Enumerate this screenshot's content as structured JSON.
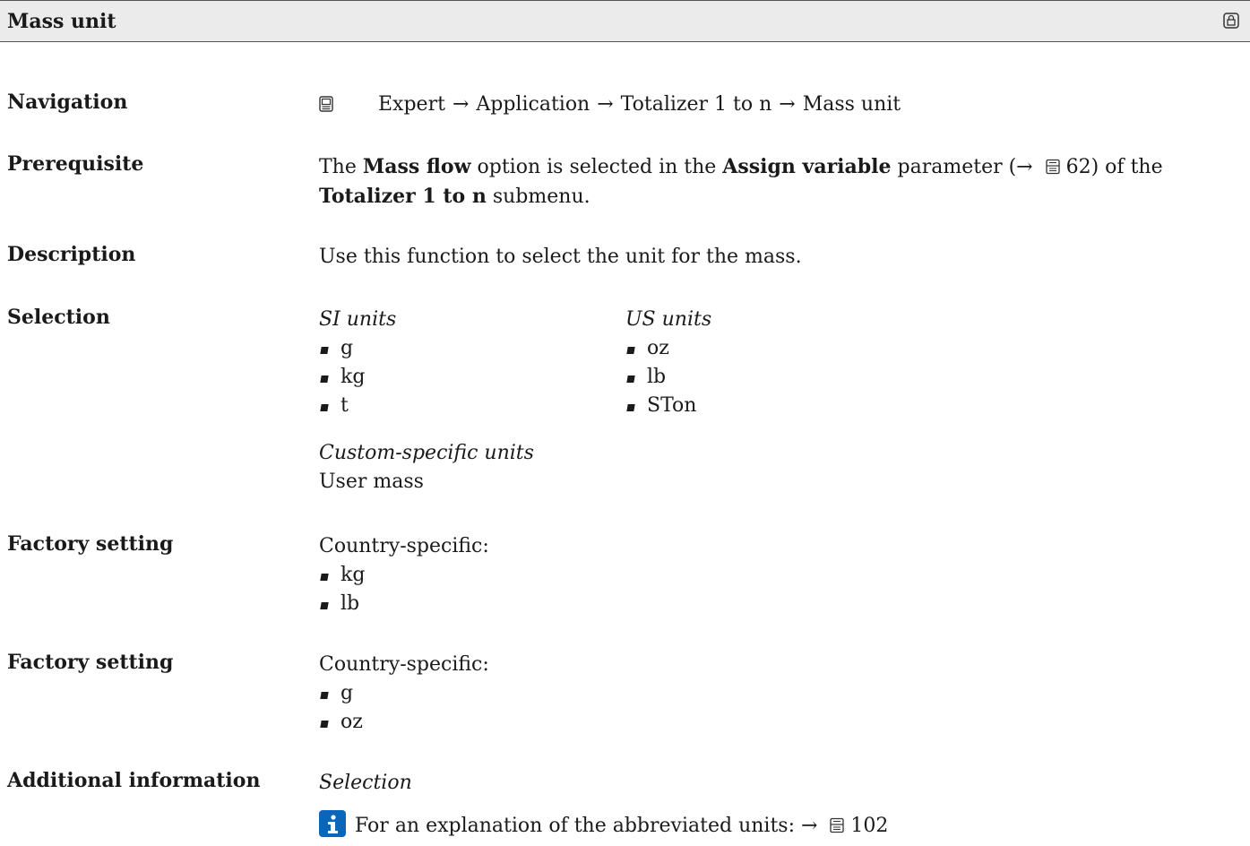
{
  "header": {
    "title": "Mass unit",
    "lock_icon": "lock-icon"
  },
  "navigation": {
    "label": "Navigation",
    "icon": "display-icon",
    "path": [
      "Expert",
      "Application",
      "Totalizer 1 to n",
      "Mass unit"
    ],
    "separator": "→"
  },
  "prerequisite": {
    "label": "Prerequisite",
    "t1": "The ",
    "b1": "Mass flow",
    "t2": " option is selected in the ",
    "b2": "Assign variable",
    "t3": " parameter (→ ",
    "page_ref": "62",
    "t4": ") of the",
    "b3": "Totalizer 1 to n",
    "t5": " submenu."
  },
  "description": {
    "label": "Description",
    "text": "Use this function to select the unit for the mass."
  },
  "selection": {
    "label": "Selection",
    "si_heading": "SI units",
    "si_units": [
      "g",
      "kg",
      "t"
    ],
    "us_heading": "US units",
    "us_units": [
      "oz",
      "lb",
      "STon"
    ],
    "custom_heading": "Custom-specific units",
    "custom_value": "User mass"
  },
  "factory_setting_1": {
    "label": "Factory setting",
    "intro": "Country-specific:",
    "items": [
      "kg",
      "lb"
    ]
  },
  "factory_setting_2": {
    "label": "Factory setting",
    "intro": "Country-specific:",
    "items": [
      "g",
      "oz"
    ]
  },
  "additional_information": {
    "label": "Additional information",
    "subheading": "Selection",
    "note_text": "For an explanation of the abbreviated units: → ",
    "note_page_ref": "102",
    "note_icon": "info-icon"
  },
  "colors": {
    "header_bg": "#ebebeb",
    "info_blue": "#0a66b8"
  }
}
